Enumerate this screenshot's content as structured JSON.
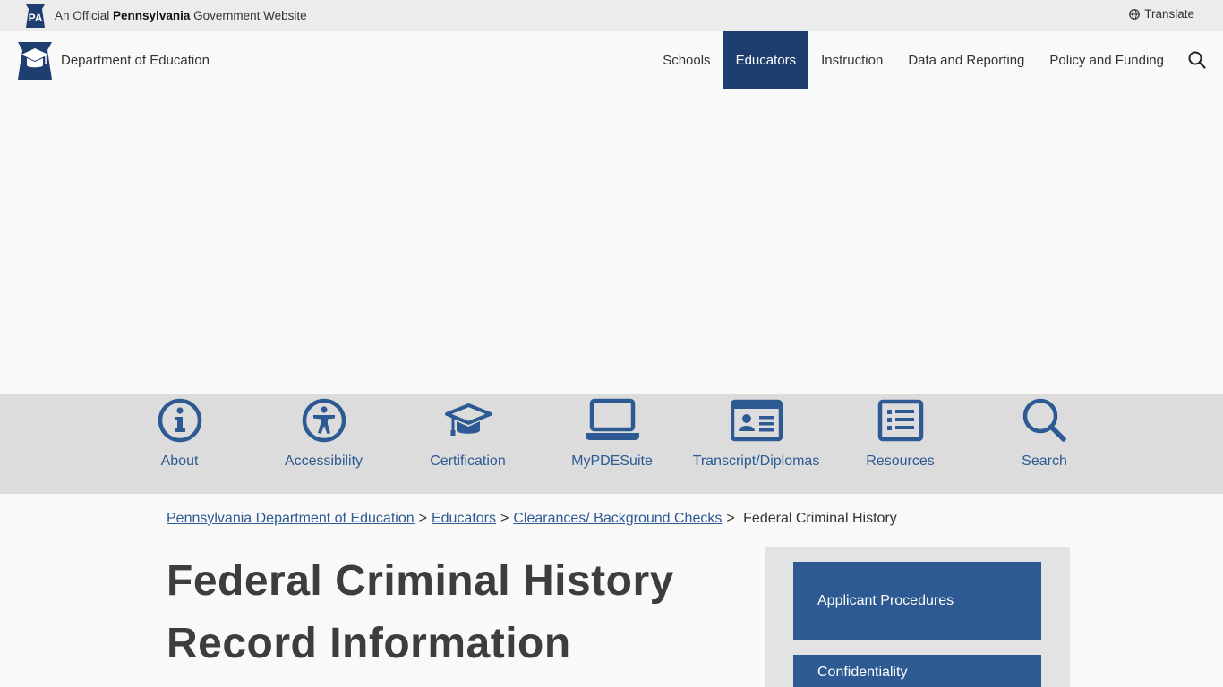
{
  "gov_bar": {
    "badge_text": "PA",
    "official_prefix": "An Official",
    "official_state": "Pennsylvania",
    "official_suffix": "Government Website",
    "translate_label": "Translate"
  },
  "header": {
    "department": "Department of Education",
    "nav": [
      {
        "label": "Schools",
        "active": false
      },
      {
        "label": "Educators",
        "active": true
      },
      {
        "label": "Instruction",
        "active": false
      },
      {
        "label": "Data and Reporting",
        "active": false
      },
      {
        "label": "Policy and Funding",
        "active": false
      }
    ],
    "accent": "#1d3e6e"
  },
  "icon_strip": {
    "items": [
      {
        "label": "About",
        "icon": "info-icon"
      },
      {
        "label": "Accessibility",
        "icon": "accessibility-icon"
      },
      {
        "label": "Certification",
        "icon": "graduation-cap-icon"
      },
      {
        "label": "MyPDESuite",
        "icon": "laptop-icon"
      },
      {
        "label": "Transcript/Diplomas",
        "icon": "id-card-icon"
      },
      {
        "label": "Resources",
        "icon": "list-icon"
      },
      {
        "label": "Search",
        "icon": "search-icon"
      }
    ],
    "icon_color": "#2d5a93"
  },
  "breadcrumb": {
    "items": [
      "Pennsylvania Department of Education",
      "Educators",
      "Clearances/ Background Checks"
    ],
    "current": "Federal Criminal History"
  },
  "page": {
    "title": "Federal Criminal History Record Information"
  },
  "sidebar": {
    "links": [
      "Applicant Procedures",
      "Confidentiality"
    ],
    "button_color": "#2d5a93"
  }
}
